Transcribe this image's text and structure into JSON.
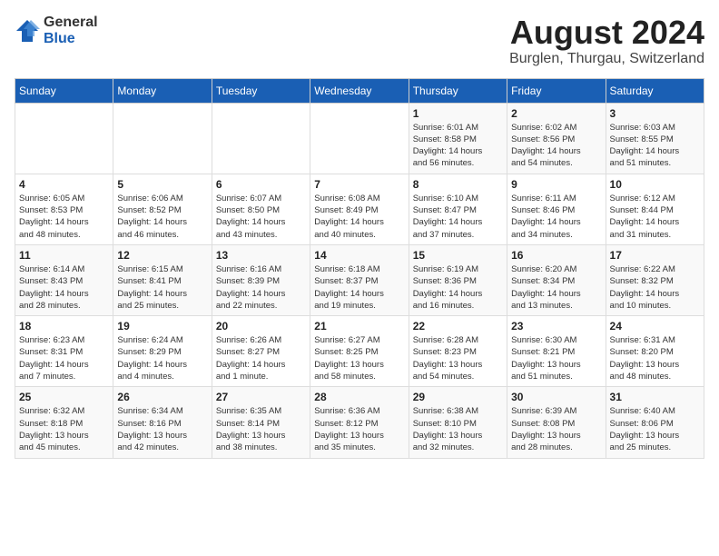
{
  "header": {
    "logo_general": "General",
    "logo_blue": "Blue",
    "month_year": "August 2024",
    "location": "Burglen, Thurgau, Switzerland"
  },
  "weekdays": [
    "Sunday",
    "Monday",
    "Tuesday",
    "Wednesday",
    "Thursday",
    "Friday",
    "Saturday"
  ],
  "weeks": [
    [
      {
        "day": "",
        "info": ""
      },
      {
        "day": "",
        "info": ""
      },
      {
        "day": "",
        "info": ""
      },
      {
        "day": "",
        "info": ""
      },
      {
        "day": "1",
        "info": "Sunrise: 6:01 AM\nSunset: 8:58 PM\nDaylight: 14 hours\nand 56 minutes."
      },
      {
        "day": "2",
        "info": "Sunrise: 6:02 AM\nSunset: 8:56 PM\nDaylight: 14 hours\nand 54 minutes."
      },
      {
        "day": "3",
        "info": "Sunrise: 6:03 AM\nSunset: 8:55 PM\nDaylight: 14 hours\nand 51 minutes."
      }
    ],
    [
      {
        "day": "4",
        "info": "Sunrise: 6:05 AM\nSunset: 8:53 PM\nDaylight: 14 hours\nand 48 minutes."
      },
      {
        "day": "5",
        "info": "Sunrise: 6:06 AM\nSunset: 8:52 PM\nDaylight: 14 hours\nand 46 minutes."
      },
      {
        "day": "6",
        "info": "Sunrise: 6:07 AM\nSunset: 8:50 PM\nDaylight: 14 hours\nand 43 minutes."
      },
      {
        "day": "7",
        "info": "Sunrise: 6:08 AM\nSunset: 8:49 PM\nDaylight: 14 hours\nand 40 minutes."
      },
      {
        "day": "8",
        "info": "Sunrise: 6:10 AM\nSunset: 8:47 PM\nDaylight: 14 hours\nand 37 minutes."
      },
      {
        "day": "9",
        "info": "Sunrise: 6:11 AM\nSunset: 8:46 PM\nDaylight: 14 hours\nand 34 minutes."
      },
      {
        "day": "10",
        "info": "Sunrise: 6:12 AM\nSunset: 8:44 PM\nDaylight: 14 hours\nand 31 minutes."
      }
    ],
    [
      {
        "day": "11",
        "info": "Sunrise: 6:14 AM\nSunset: 8:43 PM\nDaylight: 14 hours\nand 28 minutes."
      },
      {
        "day": "12",
        "info": "Sunrise: 6:15 AM\nSunset: 8:41 PM\nDaylight: 14 hours\nand 25 minutes."
      },
      {
        "day": "13",
        "info": "Sunrise: 6:16 AM\nSunset: 8:39 PM\nDaylight: 14 hours\nand 22 minutes."
      },
      {
        "day": "14",
        "info": "Sunrise: 6:18 AM\nSunset: 8:37 PM\nDaylight: 14 hours\nand 19 minutes."
      },
      {
        "day": "15",
        "info": "Sunrise: 6:19 AM\nSunset: 8:36 PM\nDaylight: 14 hours\nand 16 minutes."
      },
      {
        "day": "16",
        "info": "Sunrise: 6:20 AM\nSunset: 8:34 PM\nDaylight: 14 hours\nand 13 minutes."
      },
      {
        "day": "17",
        "info": "Sunrise: 6:22 AM\nSunset: 8:32 PM\nDaylight: 14 hours\nand 10 minutes."
      }
    ],
    [
      {
        "day": "18",
        "info": "Sunrise: 6:23 AM\nSunset: 8:31 PM\nDaylight: 14 hours\nand 7 minutes."
      },
      {
        "day": "19",
        "info": "Sunrise: 6:24 AM\nSunset: 8:29 PM\nDaylight: 14 hours\nand 4 minutes."
      },
      {
        "day": "20",
        "info": "Sunrise: 6:26 AM\nSunset: 8:27 PM\nDaylight: 14 hours\nand 1 minute."
      },
      {
        "day": "21",
        "info": "Sunrise: 6:27 AM\nSunset: 8:25 PM\nDaylight: 13 hours\nand 58 minutes."
      },
      {
        "day": "22",
        "info": "Sunrise: 6:28 AM\nSunset: 8:23 PM\nDaylight: 13 hours\nand 54 minutes."
      },
      {
        "day": "23",
        "info": "Sunrise: 6:30 AM\nSunset: 8:21 PM\nDaylight: 13 hours\nand 51 minutes."
      },
      {
        "day": "24",
        "info": "Sunrise: 6:31 AM\nSunset: 8:20 PM\nDaylight: 13 hours\nand 48 minutes."
      }
    ],
    [
      {
        "day": "25",
        "info": "Sunrise: 6:32 AM\nSunset: 8:18 PM\nDaylight: 13 hours\nand 45 minutes."
      },
      {
        "day": "26",
        "info": "Sunrise: 6:34 AM\nSunset: 8:16 PM\nDaylight: 13 hours\nand 42 minutes."
      },
      {
        "day": "27",
        "info": "Sunrise: 6:35 AM\nSunset: 8:14 PM\nDaylight: 13 hours\nand 38 minutes."
      },
      {
        "day": "28",
        "info": "Sunrise: 6:36 AM\nSunset: 8:12 PM\nDaylight: 13 hours\nand 35 minutes."
      },
      {
        "day": "29",
        "info": "Sunrise: 6:38 AM\nSunset: 8:10 PM\nDaylight: 13 hours\nand 32 minutes."
      },
      {
        "day": "30",
        "info": "Sunrise: 6:39 AM\nSunset: 8:08 PM\nDaylight: 13 hours\nand 28 minutes."
      },
      {
        "day": "31",
        "info": "Sunrise: 6:40 AM\nSunset: 8:06 PM\nDaylight: 13 hours\nand 25 minutes."
      }
    ]
  ]
}
